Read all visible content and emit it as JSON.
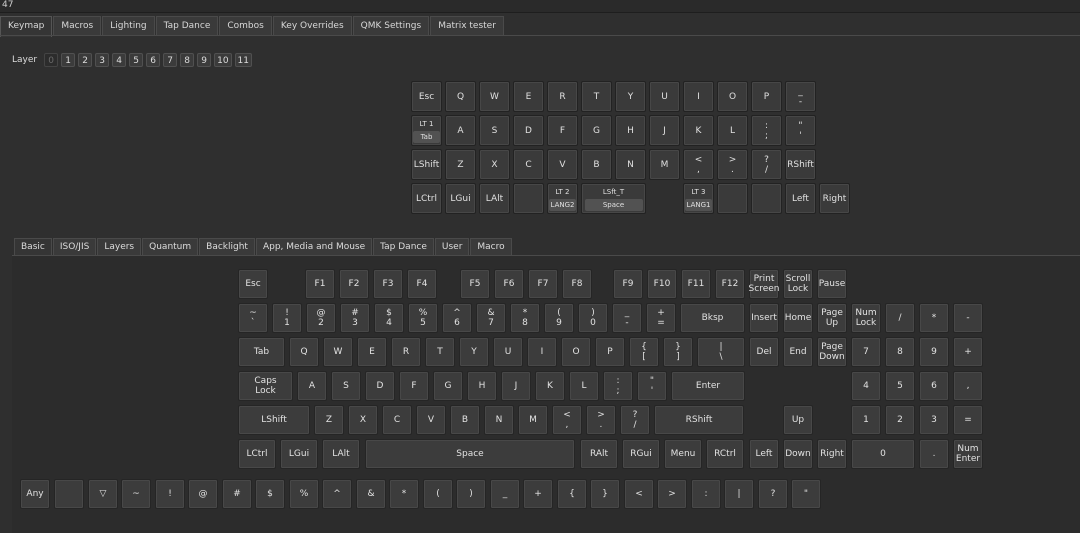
{
  "window": {
    "title": "47"
  },
  "main_tabs": [
    {
      "label": "Keymap",
      "active": true
    },
    {
      "label": "Macros"
    },
    {
      "label": "Lighting"
    },
    {
      "label": "Tap Dance"
    },
    {
      "label": "Combos"
    },
    {
      "label": "Key Overrides"
    },
    {
      "label": "QMK Settings"
    },
    {
      "label": "Matrix tester"
    }
  ],
  "layer": {
    "label": "Layer",
    "buttons": [
      "0",
      "1",
      "2",
      "3",
      "4",
      "5",
      "6",
      "7",
      "8",
      "9",
      "10",
      "11"
    ],
    "active": "0"
  },
  "keymap": {
    "rows": [
      [
        {
          "t": "Esc"
        },
        {
          "t": "Q"
        },
        {
          "t": "W"
        },
        {
          "t": "E"
        },
        {
          "t": "R"
        },
        {
          "t": "T"
        },
        {
          "t": "Y"
        },
        {
          "t": "U"
        },
        {
          "t": "I"
        },
        {
          "t": "O"
        },
        {
          "t": "P"
        },
        {
          "t": "_\n-"
        }
      ],
      [
        {
          "top": "LT 1",
          "sub": "Tab"
        },
        {
          "t": "A"
        },
        {
          "t": "S"
        },
        {
          "t": "D"
        },
        {
          "t": "F"
        },
        {
          "t": "G"
        },
        {
          "t": "H"
        },
        {
          "t": "J"
        },
        {
          "t": "K"
        },
        {
          "t": "L"
        },
        {
          "t": ":\n;"
        },
        {
          "t": "\"\n'"
        }
      ],
      [
        {
          "t": "LShift"
        },
        {
          "t": "Z"
        },
        {
          "t": "X"
        },
        {
          "t": "C"
        },
        {
          "t": "V"
        },
        {
          "t": "B"
        },
        {
          "t": "N"
        },
        {
          "t": "M"
        },
        {
          "t": "<\n,"
        },
        {
          "t": ">\n."
        },
        {
          "t": "?\n/"
        },
        {
          "t": "RShift"
        }
      ],
      [
        {
          "t": "LCtrl"
        },
        {
          "t": "LGui"
        },
        {
          "t": "LAlt"
        },
        {
          "t": ""
        },
        {
          "top": "LT 2",
          "sub": "LANG2"
        },
        {
          "top": "LSft_T",
          "sub": "Space",
          "wide": true
        },
        {
          "top": "LT 3",
          "sub": "LANG1"
        },
        {
          "t": ""
        },
        {
          "t": ""
        },
        {
          "t": "Left"
        },
        {
          "t": "Right"
        }
      ]
    ]
  },
  "keycode_tabs": [
    {
      "label": "Basic",
      "active": true
    },
    {
      "label": "ISO/JIS"
    },
    {
      "label": "Layers"
    },
    {
      "label": "Quantum"
    },
    {
      "label": "Backlight"
    },
    {
      "label": "App, Media and Mouse"
    },
    {
      "label": "Tap Dance"
    },
    {
      "label": "User"
    },
    {
      "label": "Macro"
    }
  ],
  "palette": {
    "row1": [
      "Esc",
      "F1",
      "F2",
      "F3",
      "F4",
      "F5",
      "F6",
      "F7",
      "F8",
      "F9",
      "F10",
      "F11",
      "F12",
      "Print\nScreen",
      "Scroll\nLock",
      "Pause"
    ],
    "row2": [
      "~\n`",
      "!\n1",
      "@\n2",
      "#\n3",
      "$\n4",
      "%\n5",
      "^\n6",
      "&\n7",
      "*\n8",
      "(\n9",
      ")\n0",
      "_\n-",
      "+\n=",
      "Bksp",
      "Insert",
      "Home",
      "Page\nUp",
      "Num\nLock",
      "/",
      "*",
      "-"
    ],
    "row3": [
      "Tab",
      "Q",
      "W",
      "E",
      "R",
      "T",
      "Y",
      "U",
      "I",
      "O",
      "P",
      "{\n[",
      "}\n]",
      "|\n\\",
      "Del",
      "End",
      "Page\nDown",
      "7",
      "8",
      "9",
      "+"
    ],
    "row4": [
      "Caps\nLock",
      "A",
      "S",
      "D",
      "F",
      "G",
      "H",
      "J",
      "K",
      "L",
      ":\n;",
      "\"\n'",
      "Enter",
      "4",
      "5",
      "6",
      ","
    ],
    "row5": [
      "LShift",
      "Z",
      "X",
      "C",
      "V",
      "B",
      "N",
      "M",
      "<\n,",
      ">\n.",
      "?\n/",
      "RShift",
      "Up",
      "1",
      "2",
      "3",
      "="
    ],
    "row6": [
      "LCtrl",
      "LGui",
      "LAlt",
      "Space",
      "RAlt",
      "RGui",
      "Menu",
      "RCtrl",
      "Left",
      "Down",
      "Right",
      "0",
      ".",
      "Num\nEnter"
    ],
    "symbols": [
      "Any",
      "",
      "▽",
      "~",
      "!",
      "@",
      "#",
      "$",
      "%",
      "^",
      "&",
      "*",
      "(",
      ")",
      "_",
      "+",
      "{",
      "}",
      "<",
      ">",
      ":",
      "|",
      "?",
      "\""
    ]
  }
}
